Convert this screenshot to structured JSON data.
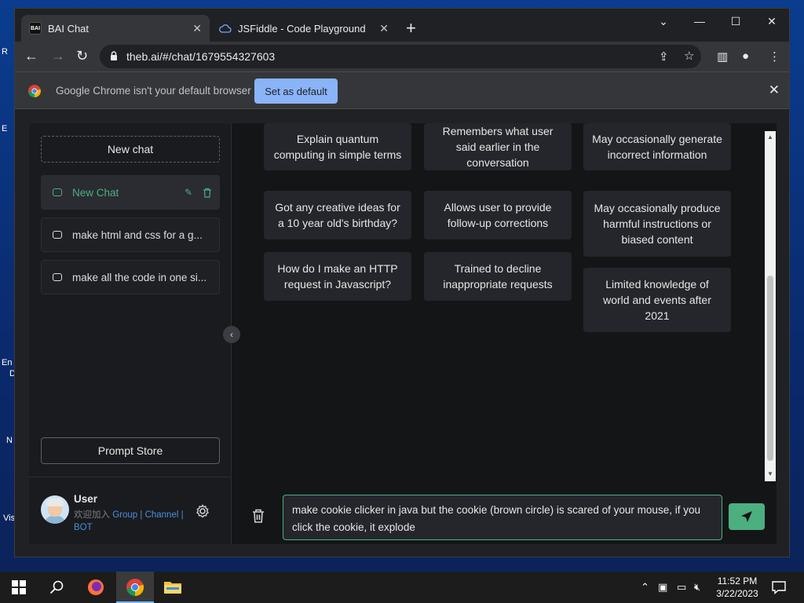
{
  "desktop": {
    "labels": [
      "R",
      "E",
      "En",
      "D",
      "N",
      "Vis"
    ]
  },
  "browser": {
    "tabs": [
      {
        "title": "BAI Chat",
        "favicon": "BAI",
        "active": true
      },
      {
        "title": "JSFiddle - Code Playground",
        "favicon": "cloud-icon",
        "active": false
      }
    ],
    "url": "theb.ai/#/chat/1679554327603",
    "infobar": {
      "message": "Google Chrome isn't your default browser",
      "button": "Set as default"
    }
  },
  "sidebar": {
    "new_chat": "New chat",
    "chats": [
      {
        "label": "New Chat",
        "active": true
      },
      {
        "label": "make html and css for a g...",
        "active": false
      },
      {
        "label": "make all the code in one si...",
        "active": false
      }
    ],
    "prompt_store": "Prompt Store",
    "user": {
      "name": "User",
      "prefix": "欢迎加入",
      "link_group": "Group",
      "sep1": " | ",
      "link_channel": "Channel",
      "sep2": " |",
      "link_bot": "BOT"
    }
  },
  "cards": {
    "examples": [
      "Explain quantum computing in simple terms",
      "Got any creative ideas for a 10 year old's birthday?",
      "How do I make an HTTP request in Javascript?"
    ],
    "capabilities": [
      "Remembers what user said earlier in the conversation",
      "Allows user to provide follow-up corrections",
      "Trained to decline inappropriate requests"
    ],
    "limitations": [
      "May occasionally generate incorrect information",
      "May occasionally produce harmful instructions or biased content",
      "Limited knowledge of world and events after 2021"
    ]
  },
  "input": {
    "value": "make cookie clicker in java but the cookie (brown circle) is scared of your mouse, if you click the cookie, it explode"
  },
  "taskbar": {
    "time": "11:52 PM",
    "date": "3/22/2023"
  },
  "colors": {
    "accent": "#4caf7f",
    "link": "#4a8fe0",
    "chrome_blue": "#8ab4f8"
  }
}
